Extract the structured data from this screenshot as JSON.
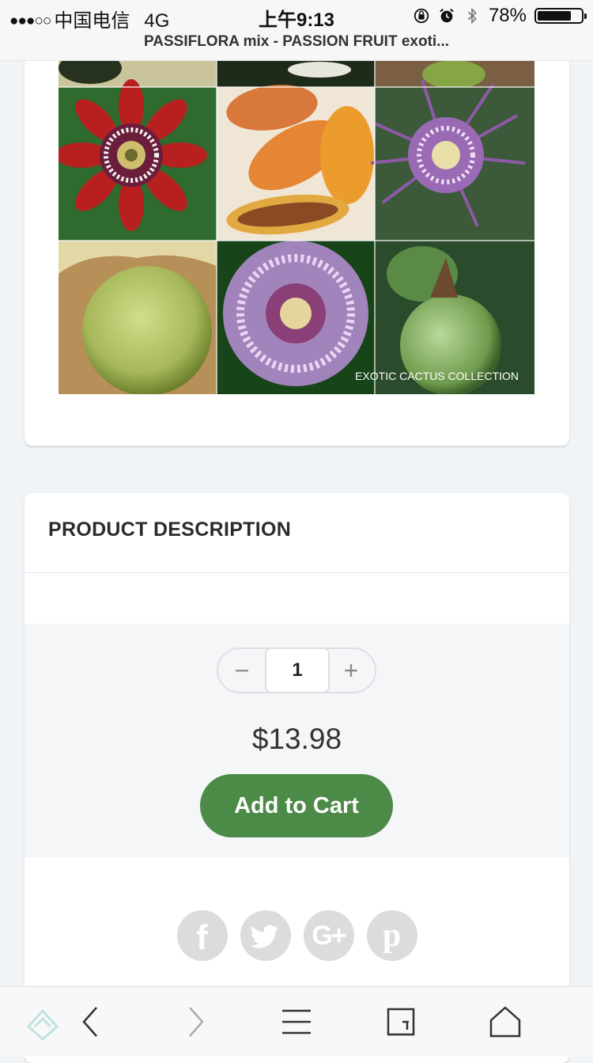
{
  "status_bar": {
    "signal": "●●●○○",
    "carrier": "中国电信",
    "network": "4G",
    "time": "上午9:13",
    "battery_percent": "78%",
    "battery_level": 0.78,
    "icons": [
      "orientation-lock-icon",
      "alarm-icon",
      "bluetooth-icon",
      "battery-icon"
    ]
  },
  "browser": {
    "page_title": "PASSIFLORA mix - PASSION FRUIT exoti..."
  },
  "product": {
    "photo_caption": "EXOTIC CACTUS COLLECTION",
    "description_heading": "PRODUCT DESCRIPTION",
    "quantity": "1",
    "minus_label": "−",
    "plus_label": "+",
    "price": "$13.98",
    "add_to_cart_label": "Add to Cart"
  },
  "share": {
    "facebook": "f",
    "twitter": "twitter-bird-icon",
    "google_plus": "G+",
    "pinterest": "p"
  },
  "toolbar": {
    "buttons": [
      "back-icon",
      "forward-icon",
      "menu-icon",
      "windows-icon",
      "home-icon"
    ]
  },
  "colors": {
    "accent": "#4c8a47",
    "background": "#f1f4f7",
    "share_icon": "#dcdcdc"
  }
}
